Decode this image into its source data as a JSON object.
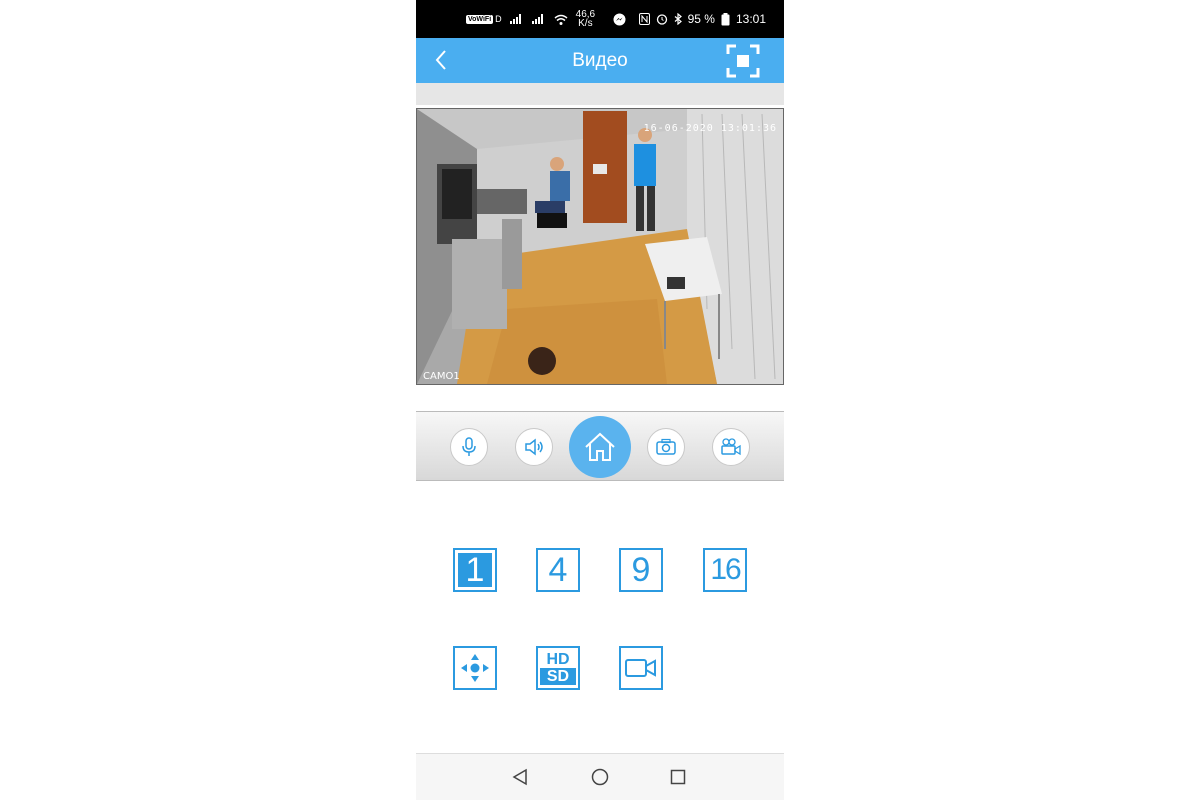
{
  "status_bar": {
    "volte": "VoWiFi",
    "volte_suffix": "D",
    "speed_value": "46,6",
    "speed_unit": "K/s",
    "battery": "95 %",
    "time": "13:01",
    "icons": [
      "signal-icon",
      "wifi-icon",
      "messenger-icon",
      "nfc-icon",
      "alarm-icon",
      "bluetooth-icon",
      "battery-icon"
    ]
  },
  "app_bar": {
    "title": "Видео",
    "back_icon": "chevron-left-icon",
    "fullscreen_icon": "fullscreen-icon",
    "color": "#4aaef0"
  },
  "video": {
    "camera_label": "CAMO1",
    "timestamp": "16-06-2020 13:01:36"
  },
  "controls": {
    "items": [
      "microphone-icon",
      "speaker-icon",
      "home-icon",
      "camera-icon",
      "video-record-icon"
    ],
    "active": "home-icon"
  },
  "layout_buttons": {
    "items": [
      "1",
      "4",
      "9",
      "16"
    ],
    "selected": "1"
  },
  "function_buttons": {
    "ptz_icon": "ptz-direction-icon",
    "hd_label": "HD",
    "sd_label": "SD",
    "record_icon": "video-record-icon"
  },
  "nav": {
    "items": [
      "back-triangle-icon",
      "home-circle-icon",
      "recents-square-icon"
    ]
  },
  "colors": {
    "accent": "#2b9ae0",
    "appbar": "#4aaef0"
  }
}
